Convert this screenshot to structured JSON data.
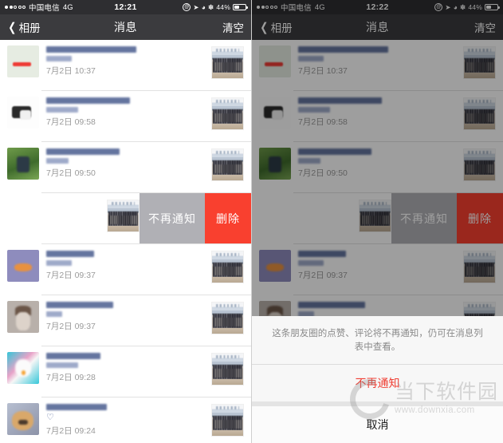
{
  "status_bar": {
    "signal_dots_filled": 2,
    "signal_dots_total": 5,
    "carrier": "中国电信",
    "network": "4G",
    "time_left": "12:21",
    "time_right": "12:22",
    "icons": [
      "rotation-lock-icon",
      "location-arrow-icon",
      "alarm-clock-icon",
      "bluetooth-icon"
    ],
    "battery_percent": "44%"
  },
  "nav": {
    "back_label": "相册",
    "title": "消息",
    "action_label": "清空"
  },
  "list": {
    "rows": [
      {
        "time": "7月2日 10:37",
        "avatar_style": "avatar-green-red",
        "has_heart": false
      },
      {
        "time": "7月2日 09:58",
        "avatar_style": "avatar-camera",
        "has_heart": false
      },
      {
        "time": "7月2日 09:50",
        "avatar_style": "avatar-greenphoto",
        "has_heart": false
      },
      {
        "time": "",
        "avatar_style": "avatar-hidden",
        "has_heart": false,
        "swiped": true
      },
      {
        "time": "7月2日 09:37",
        "avatar_style": "avatar-purple",
        "has_heart": false
      },
      {
        "time": "7月2日 09:37",
        "avatar_style": "avatar-beige",
        "has_heart": false
      },
      {
        "time": "7月2日 09:28",
        "avatar_style": "avatar-cyan",
        "has_heart": false
      },
      {
        "time": "7月2日 09:24",
        "avatar_style": "avatar-dog",
        "has_heart": true,
        "heart_glyph": "♡"
      }
    ]
  },
  "swipe_actions": {
    "mute_label": "不再通知",
    "delete_label": "删除",
    "mute_color": "#b0b0b5",
    "delete_color": "#f9402f"
  },
  "action_sheet": {
    "message": "这条朋友圈的点赞、评论将不再通知，仍可在消息列表中查看。",
    "confirm_label": "不再通知",
    "confirm_color": "#f04136",
    "cancel_label": "取消"
  },
  "watermark": {
    "brand": "当下软件园",
    "url": "www.downxia.com"
  }
}
